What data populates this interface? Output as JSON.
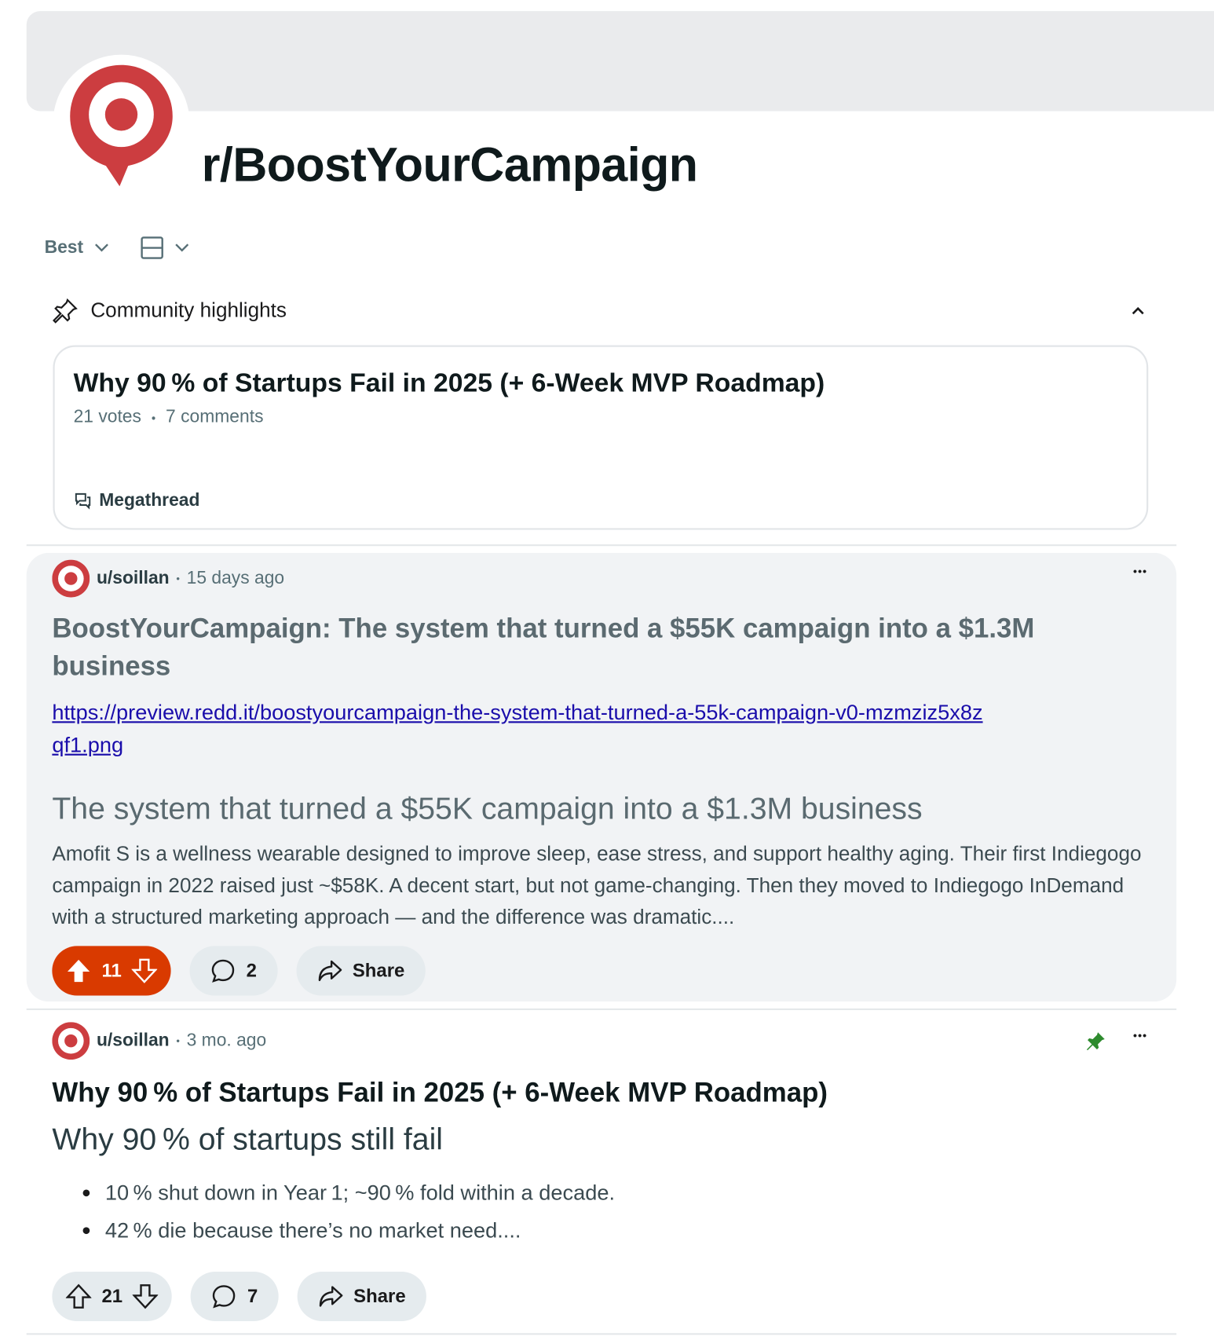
{
  "subreddit": {
    "name": "r/BoostYourCampaign"
  },
  "sort": {
    "label": "Best"
  },
  "highlights": {
    "header": "Community highlights",
    "card": {
      "title": "Why 90 % of Startups Fail in 2025 (+ 6-Week MVP Roadmap)",
      "votes": "21 votes",
      "sep": "•",
      "comments": "7 comments",
      "tag": "Megathread"
    }
  },
  "posts": [
    {
      "user": "u/soillan",
      "sep": "•",
      "time": "15 days ago",
      "more": "•••",
      "title": "BoostYourCampaign: The system that turned a $55K campaign into a $1.3M business",
      "link": "https://preview.redd.it/boostyourcampaign-the-system-that-turned-a-55k-campaign-v0-mzmziz5x8zqf1.png",
      "heading": "The system that turned a $55K campaign into a $1.3M business",
      "body": "Amofit S is a wellness wearable designed to improve sleep, ease stress, and support healthy aging. Their first Indiegogo campaign in 2022 raised just ~$58K. A decent start, but not game-changing. Then they moved to Indiegogo InDemand with a structured marketing approach — and the difference was dramatic....",
      "score": "11",
      "comments": "2",
      "share": "Share"
    },
    {
      "user": "u/soillan",
      "sep": "•",
      "time": "3 mo. ago",
      "more": "•••",
      "title": "Why 90 % of Startups Fail in 2025 (+ 6-Week MVP Roadmap)",
      "heading": "Why 90 % of startups still fail",
      "bullets": [
        "10 % shut down in Year 1; ~90 % fold within a decade.",
        "42 % die because there’s no market need...."
      ],
      "score": "21",
      "comments": "7",
      "share": "Share"
    }
  ],
  "colors": {
    "accent": "#d93a00",
    "link": "#1a0dab",
    "brand_red": "#cc3d40",
    "pin_green": "#2e8b2e"
  }
}
